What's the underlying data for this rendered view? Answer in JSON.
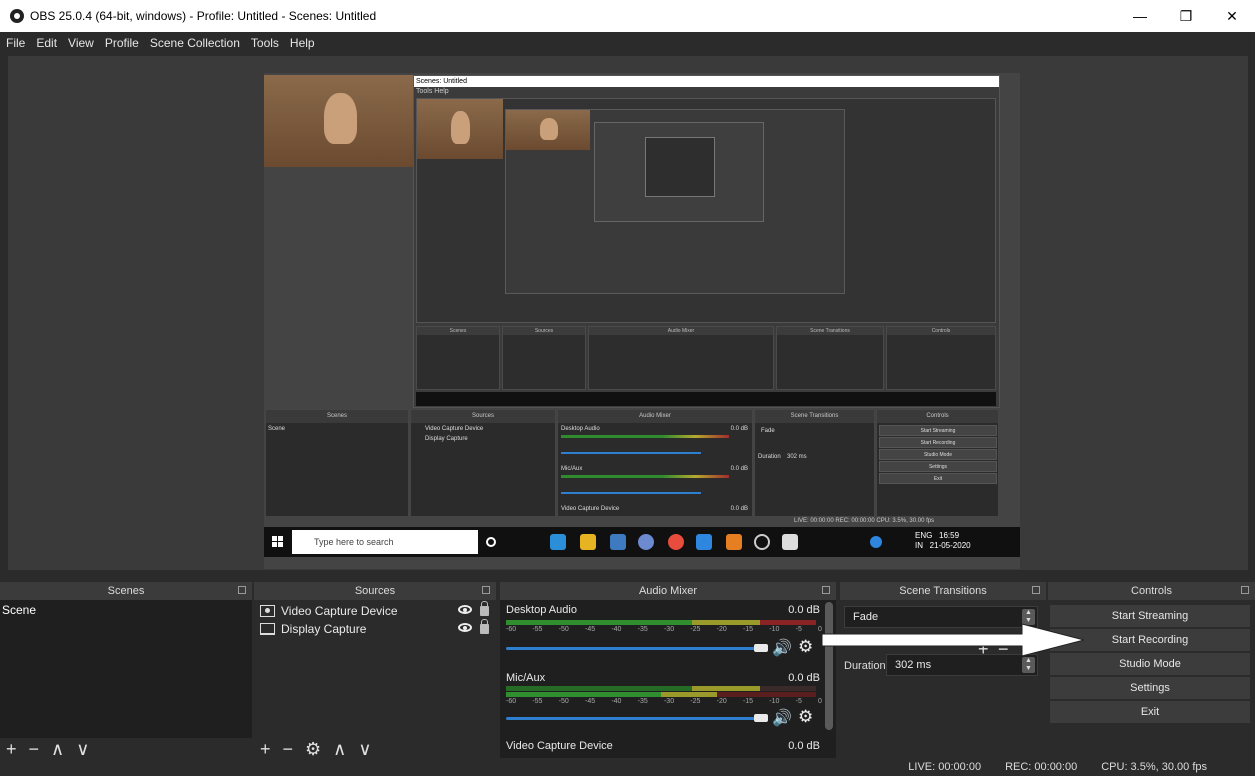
{
  "window": {
    "title": "OBS 25.0.4 (64-bit, windows) - Profile: Untitled - Scenes: Untitled",
    "minimize": "—",
    "maximize": "❐",
    "close": "✕"
  },
  "menu": [
    "File",
    "Edit",
    "View",
    "Profile",
    "Scene Collection",
    "Tools",
    "Help"
  ],
  "preview": {
    "nested_title": "Scenes: Untitled",
    "nested_menu": "Tools  Help",
    "docks": [
      "Scenes",
      "Sources",
      "Audio Mixer",
      "Scene Transitions",
      "Controls"
    ],
    "scene": "Scene",
    "sources": [
      "Video Capture Device",
      "Display Capture"
    ],
    "mixer": [
      "Desktop Audio",
      "Mic/Aux",
      "Video Capture Device"
    ],
    "db": [
      "0.0 dB",
      "0.0 dB",
      "0.0 dB"
    ],
    "transition": "Fade",
    "duration_label": "Duration",
    "duration": "302 ms",
    "controls": [
      "Start Streaming",
      "Start Recording",
      "Studio Mode",
      "Settings",
      "Exit"
    ],
    "status": "LIVE: 00:00:00   REC: 00:00:00   CPU: 3.5%, 30.00 fps",
    "search_placeholder": "Type here to search",
    "tray_lang": "ENG",
    "tray_region": "IN",
    "tray_time": "16:59",
    "tray_date": "21-05-2020"
  },
  "scenes": {
    "header": "Scenes",
    "items": [
      "Scene"
    ],
    "toolbar": [
      "+",
      "−",
      "∧",
      "∨"
    ]
  },
  "sources": {
    "header": "Sources",
    "items": [
      "Video Capture Device",
      "Display Capture"
    ],
    "toolbar": [
      "+",
      "−",
      "⚙",
      "∧",
      "∨"
    ]
  },
  "mixer": {
    "header": "Audio Mixer",
    "tracks": [
      {
        "name": "Desktop Audio",
        "db": "0.0 dB"
      },
      {
        "name": "Mic/Aux",
        "db": "0.0 dB"
      },
      {
        "name": "Video Capture Device",
        "db": "0.0 dB"
      }
    ],
    "ticks": [
      "-60",
      "-55",
      "-50",
      "-45",
      "-40",
      "-35",
      "-30",
      "-25",
      "-20",
      "-15",
      "-10",
      "-5",
      "0"
    ]
  },
  "transitions": {
    "header": "Scene Transitions",
    "selected": "Fade",
    "duration_label": "Duration",
    "duration_value": "302 ms",
    "add": "+",
    "remove": "−"
  },
  "controls": {
    "header": "Controls",
    "buttons": [
      "Start Streaming",
      "Start Recording",
      "Studio Mode",
      "Settings",
      "Exit"
    ]
  },
  "status": {
    "live": "LIVE: 00:00:00",
    "rec": "REC: 00:00:00",
    "cpu": "CPU: 3.5%, 30.00 fps"
  },
  "colors": {
    "panel": "#2b2b2b",
    "header": "#3b3b3b",
    "accent_blue": "#2f7fd1",
    "meter_green": "#2f8f2f"
  }
}
